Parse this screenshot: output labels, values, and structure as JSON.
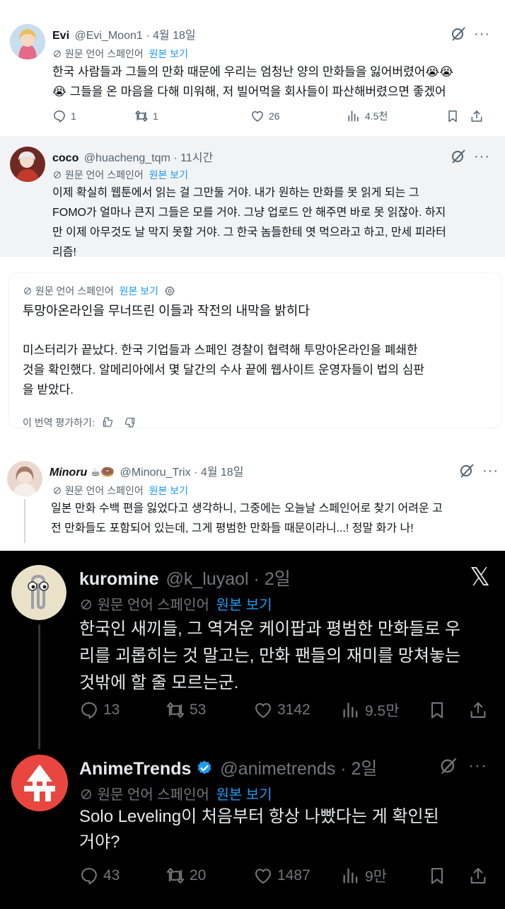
{
  "tweet1": {
    "name": "Evi",
    "handle": "@Evi_Moon1",
    "time": "4월 18일",
    "translated_note": "원문 언어 스페인어",
    "view_original": "원본 보기",
    "line1": "한국 사람들과 그들의 만화 때문에 우리는 엄청난 양의 만화들을 잃어버렸어😭😭",
    "line2": "😭 그들을 온 마음을 다해 미워해, 저 빌어먹을 회사들이 파산해버렸으면 좋겠어",
    "replies": "1",
    "retweets": "1",
    "likes": "26",
    "views": "4.5천"
  },
  "tweet2": {
    "name": "coco",
    "handle": "@huacheng_tqm",
    "time": "11시간",
    "translated_note": "원문 언어 스페인어",
    "view_original": "원본 보기",
    "lines": [
      "이제 확실히 웹툰에서 읽는 걸 그만둘 거야. 내가 원하는 만화를 못 읽게 되는 그",
      "FOMO가 얼마나 큰지 그들은 모를 거야. 그냥 업로드 안 해주면 바로 못 읽잖아. 하지",
      "만 이제 아무것도 날 막지 못할 거야. 그 한국 놈들한테 엿 먹으라고 하고, 만세 피라터",
      "리즘!"
    ]
  },
  "card": {
    "translated_note": "원문 언어 스페인어",
    "view_original": "원본 보기",
    "headline": "투망아온라인을 무너뜨린 이들과 작전의 내막을 밝히다",
    "lines": [
      "미스터리가 끝났다. 한국 기업들과 스페인 경찰이 협력해 투망아온라인을 폐쇄한",
      "것을 확인했다. 알메리아에서 몇 달간의 수사 끝에 웹사이트 운영자들이 법의 심판",
      "을 받았다."
    ],
    "rate_label": "이 번역 평가하기:"
  },
  "tweet3": {
    "name": "Minoru",
    "emoji": "☕🍩",
    "handle": "@Minoru_Trix",
    "time": "4월 18일",
    "translated_note": "원문 언어 스페인어",
    "view_original": "원본 보기",
    "lines": [
      "일본 만화 수백 편을 잃었다고 생각하니, 그중에는 오늘날 스페인어로 찾기 어려운 고",
      "전 만화들도 포함되어 있는데, 그게 평범한 만화들 때문이라니...! 정말 화가 나!"
    ]
  },
  "tweet4": {
    "name": "kuromine",
    "handle": "@k_luyaol",
    "time": "2일",
    "translated_note": "원문 언어 스페인어",
    "view_original": "원본 보기",
    "lines": [
      "한국인 새끼들, 그 역겨운 케이팝과 평범한 만화들로 우",
      "리를 괴롭히는 것 말고는, 만화 팬들의 재미를 망쳐놓는",
      "것밖에 할 줄 모르는군."
    ],
    "replies": "13",
    "retweets": "53",
    "likes": "3142",
    "views": "9.5만"
  },
  "tweet5": {
    "name": "AnimeTrends",
    "handle": "@animetrends",
    "time": "2일",
    "translated_note": "원문 언어 스페인어",
    "view_original": "원본 보기",
    "lines": [
      "Solo Leveling이 처음부터 항상 나빴다는 게 확인된",
      "거야?"
    ],
    "replies": "43",
    "retweets": "20",
    "likes": "1487",
    "views": "9만"
  },
  "icons": {
    "translate": "translate-icon",
    "grok": "grok-icon",
    "more": "more-icon",
    "reply": "reply-icon",
    "retweet": "retweet-icon",
    "like": "like-icon",
    "views": "views-icon",
    "bookmark": "bookmark-icon",
    "share": "share-icon",
    "x_logo": "x-logo-icon"
  },
  "colors": {
    "link": "#1d9bf0",
    "verified": "#1d9bf0",
    "gray_light": "#536471",
    "gray_dark": "#71767b"
  }
}
